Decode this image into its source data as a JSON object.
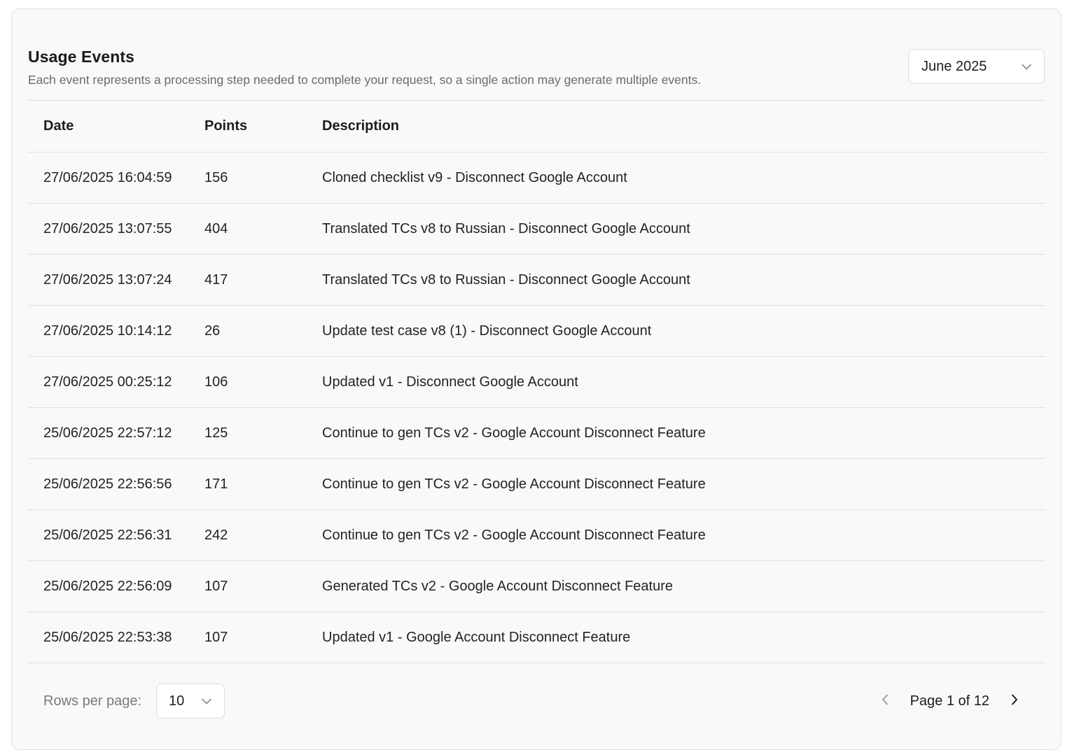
{
  "header": {
    "title": "Usage Events",
    "subtitle": "Each event represents a processing step needed to complete your request, so a single action may generate multiple events."
  },
  "month_filter": {
    "value": "June 2025",
    "icon": "chevron-down-icon"
  },
  "table": {
    "columns": [
      "Date",
      "Points",
      "Description"
    ],
    "rows": [
      {
        "date": "27/06/2025 16:04:59",
        "points": "156",
        "description": "Cloned checklist v9 - Disconnect Google Account"
      },
      {
        "date": "27/06/2025 13:07:55",
        "points": "404",
        "description": "Translated TCs v8 to Russian - Disconnect Google Account"
      },
      {
        "date": "27/06/2025 13:07:24",
        "points": "417",
        "description": "Translated TCs v8 to Russian - Disconnect Google Account"
      },
      {
        "date": "27/06/2025 10:14:12",
        "points": "26",
        "description": "Update test case v8 (1) - Disconnect Google Account"
      },
      {
        "date": "27/06/2025 00:25:12",
        "points": "106",
        "description": "Updated v1 - Disconnect Google Account"
      },
      {
        "date": "25/06/2025 22:57:12",
        "points": "125",
        "description": "Continue to gen TCs v2 - Google Account Disconnect Feature"
      },
      {
        "date": "25/06/2025 22:56:56",
        "points": "171",
        "description": "Continue to gen TCs v2 - Google Account Disconnect Feature"
      },
      {
        "date": "25/06/2025 22:56:31",
        "points": "242",
        "description": "Continue to gen TCs v2 - Google Account Disconnect Feature"
      },
      {
        "date": "25/06/2025 22:56:09",
        "points": "107",
        "description": "Generated TCs v2 - Google Account Disconnect Feature"
      },
      {
        "date": "25/06/2025 22:53:38",
        "points": "107",
        "description": "Updated v1 - Google Account Disconnect Feature"
      }
    ]
  },
  "footer": {
    "rows_per_page_label": "Rows per page:",
    "rows_per_page_value": "10",
    "page_text": "Page 1 of 12",
    "prev_icon": "chevron-left-icon",
    "next_icon": "chevron-right-icon"
  },
  "colors": {
    "card_background": "#f9f9f9",
    "border": "#e0e0e0",
    "muted_text": "#6b6b6b"
  }
}
